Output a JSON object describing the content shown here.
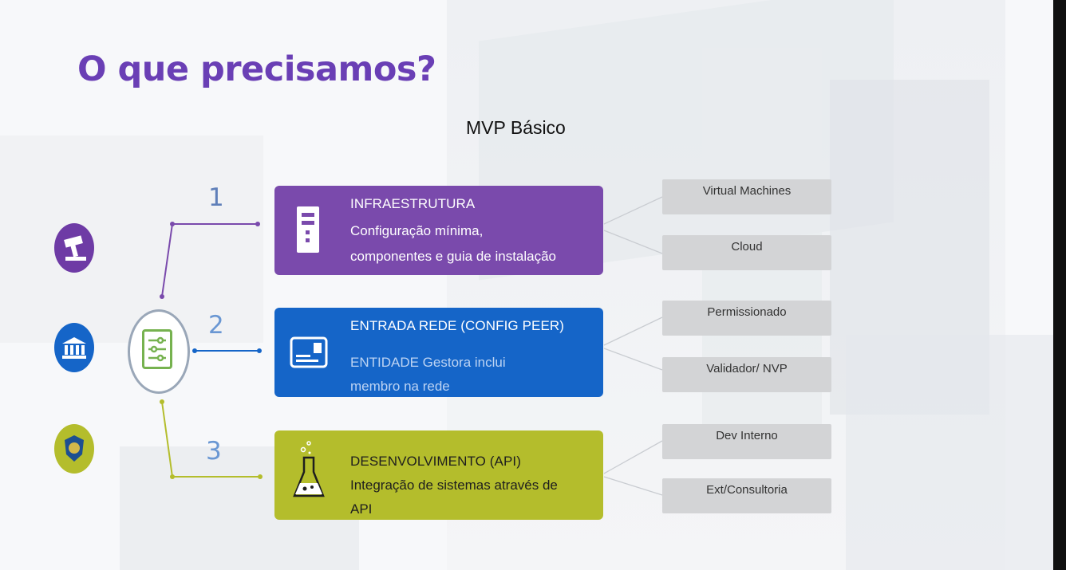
{
  "title": "O que precisamos?",
  "subtitle": "MVP Básico",
  "colors": {
    "title": "#6a3fb5",
    "infra": "#7a4aac",
    "rede": "#1565c8",
    "dev": "#b4bd2c"
  },
  "side_icons": [
    "gavel-icon",
    "bank-icon",
    "police-badge-icon"
  ],
  "hub_icon": "settings-sliders-icon",
  "steps": [
    {
      "number": "1",
      "icon": "server-tower-icon",
      "title": "INFRAESTRUTURA",
      "line1": "Configuração mínima,",
      "line2": "componentes e guia de instalação",
      "tags": [
        "Virtual Machines",
        "Cloud"
      ]
    },
    {
      "number": "2",
      "icon": "id-card-icon",
      "title": "ENTRADA REDE (CONFIG PEER)",
      "line1": "ENTIDADE  Gestora inclui",
      "line2": "membro na rede",
      "tags": [
        "Permissionado",
        "Validador/ NVP"
      ]
    },
    {
      "number": "3",
      "icon": "flask-icon",
      "title": "DESENVOLVIMENTO (API)",
      "line1": "Integração de sistemas através de",
      "line2": "API",
      "tags": [
        "Dev Interno",
        "Ext/Consultoria"
      ]
    }
  ]
}
